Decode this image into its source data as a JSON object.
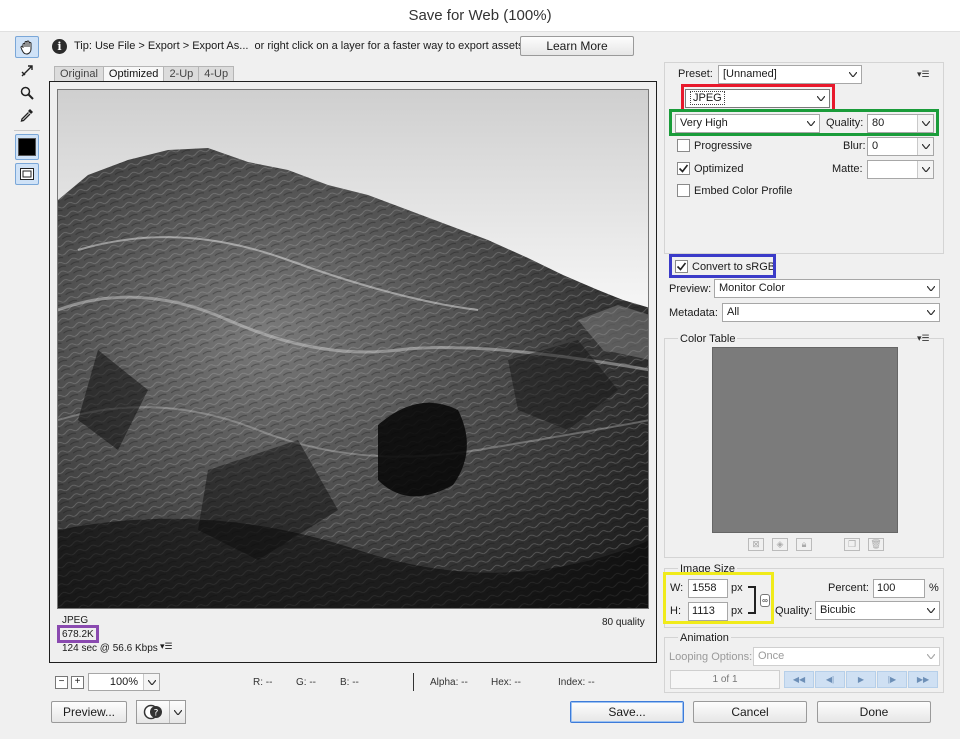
{
  "window": {
    "title": "Save for Web (100%)"
  },
  "tip": {
    "text": "Tip: Use File > Export > Export As...  or right click on a layer for a faster way to export assets",
    "learn_more": "Learn More"
  },
  "tabs": [
    {
      "label": "Original",
      "active": false
    },
    {
      "label": "Optimized",
      "active": true
    },
    {
      "label": "2-Up",
      "active": false
    },
    {
      "label": "4-Up",
      "active": false
    }
  ],
  "image_info": {
    "format": "JPEG",
    "size": "678.2K",
    "speed": "124 sec @ 56.6 Kbps",
    "quality": "80 quality"
  },
  "preset": {
    "label": "Preset:",
    "value": "[Unnamed]"
  },
  "format": {
    "value": "JPEG"
  },
  "compression": {
    "value": "Very High"
  },
  "quality": {
    "label": "Quality:",
    "value": "80"
  },
  "progressive": {
    "label": "Progressive",
    "checked": false
  },
  "blur": {
    "label": "Blur:",
    "value": "0"
  },
  "optimized": {
    "label": "Optimized",
    "checked": true
  },
  "matte": {
    "label": "Matte:",
    "value": ""
  },
  "embed_profile": {
    "label": "Embed Color Profile",
    "checked": false
  },
  "convert_srgb": {
    "label": "Convert to sRGB",
    "checked": true
  },
  "preview_select": {
    "label": "Preview:",
    "value": "Monitor Color"
  },
  "metadata": {
    "label": "Metadata:",
    "value": "All"
  },
  "color_table": {
    "label": "Color Table"
  },
  "image_size": {
    "label": "Image Size",
    "w_label": "W:",
    "w_value": "1558",
    "w_unit": "px",
    "h_label": "H:",
    "h_value": "1113",
    "h_unit": "px",
    "percent_label": "Percent:",
    "percent_value": "100",
    "percent_unit": "%",
    "quality_label": "Quality:",
    "quality_value": "Bicubic"
  },
  "animation": {
    "label": "Animation",
    "looping_label": "Looping Options:",
    "looping_value": "Once",
    "frame": "1 of 1"
  },
  "status": {
    "zoom": "100%",
    "r": "R: --",
    "g": "G: --",
    "b": "B: --",
    "alpha": "Alpha: --",
    "hex": "Hex: --",
    "index": "Index: --"
  },
  "buttons": {
    "preview": "Preview...",
    "save": "Save...",
    "cancel": "Cancel",
    "done": "Done"
  },
  "colors": {
    "red_highlight": "#e8192c",
    "green_highlight": "#1a9c3a",
    "blue_highlight": "#3b3bc8",
    "yellow_highlight": "#f0eb1a",
    "purple_highlight": "#8a4ab0",
    "color_table_fill": "#7b7b7b"
  }
}
